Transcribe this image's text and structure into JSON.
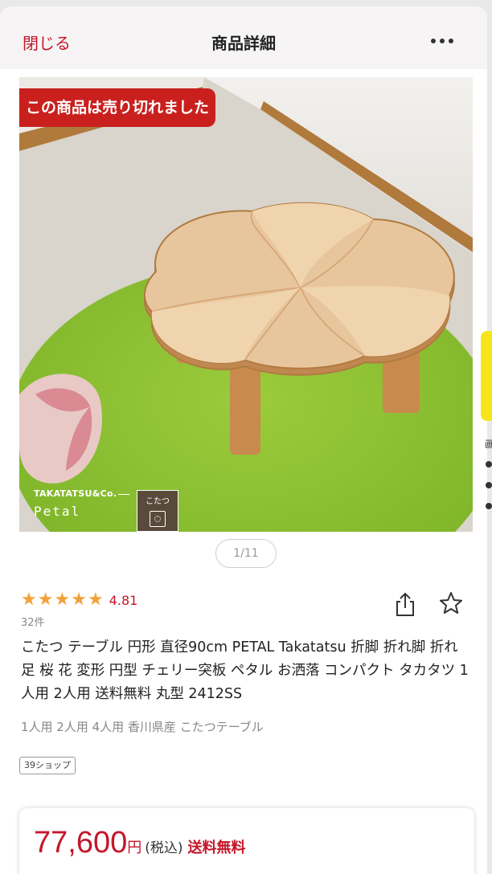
{
  "header": {
    "close_label": "閉じる",
    "title": "商品詳細"
  },
  "image": {
    "sold_out_label": "この商品は売り切れました",
    "brand_company": "TAKATATSU&Co.",
    "brand_name": "Petal",
    "badge_label": "こたつ",
    "pager": "1/11"
  },
  "rating": {
    "value": "4.81",
    "stars": 5,
    "review_count": "32件"
  },
  "product": {
    "title": "こたつ テーブル 円形 直径90cm PETAL Takatatsu 折脚 折れ脚 折れ足 桜 花 変形 円型 チェリー突板 ペタル お洒落 コンパクト タカタツ 1人用 2人用 送料無料 丸型 2412SS",
    "tags": "1人用 2人用 4人用 香川県産 こたつテーブル",
    "shop_badge": "39ショップ"
  },
  "price": {
    "amount": "77,600",
    "currency": "円",
    "tax_note": "(税込)",
    "shipping": "送料無料"
  },
  "side": {
    "text": "画"
  },
  "colors": {
    "accent": "#c4162a",
    "star": "#f3a13a",
    "sold_out_bg": "#c9201e",
    "side_tab": "#f5e61c"
  }
}
